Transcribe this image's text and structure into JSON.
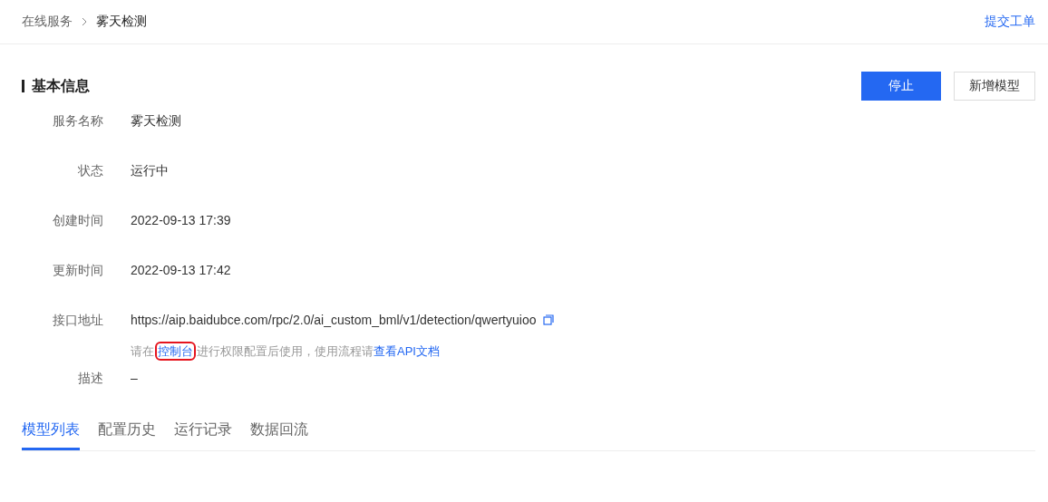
{
  "breadcrumb": [
    {
      "label": "在线服务",
      "selected": false
    },
    {
      "label": "雾天检测",
      "selected": true
    }
  ],
  "header_link": "提交工单",
  "section_title": "基本信息",
  "buttons": [
    {
      "label": "停止",
      "kind": "primary"
    },
    {
      "label": "新增模型",
      "kind": "default"
    }
  ],
  "fields": [
    {
      "label": "服务名称",
      "value": "雾天检测"
    },
    {
      "label": "状态",
      "value": "运行中"
    },
    {
      "label": "创建时间",
      "value": "2022-09-13 17:39"
    },
    {
      "label": "更新时间",
      "value": "2022-09-13 17:42"
    },
    {
      "label": "接口地址",
      "value": "https://aip.baidubce.com/rpc/2.0/ai_custom_bml/v1/detection/qwertyuioo",
      "copyable": true,
      "hint": [
        {
          "kind": "text",
          "text": "请在"
        },
        {
          "kind": "link",
          "text": "控制台",
          "highlighted": true
        },
        {
          "kind": "text",
          "text": "进行权限配置后使用，使用流程请"
        },
        {
          "kind": "link",
          "text": "查看API文档",
          "highlighted": false
        }
      ]
    },
    {
      "label": "描述",
      "value": "–"
    }
  ],
  "tabs": [
    {
      "label": "模型列表",
      "selected": true
    },
    {
      "label": "配置历史",
      "selected": false
    },
    {
      "label": "运行记录",
      "selected": false
    },
    {
      "label": "数据回流",
      "selected": false
    }
  ]
}
